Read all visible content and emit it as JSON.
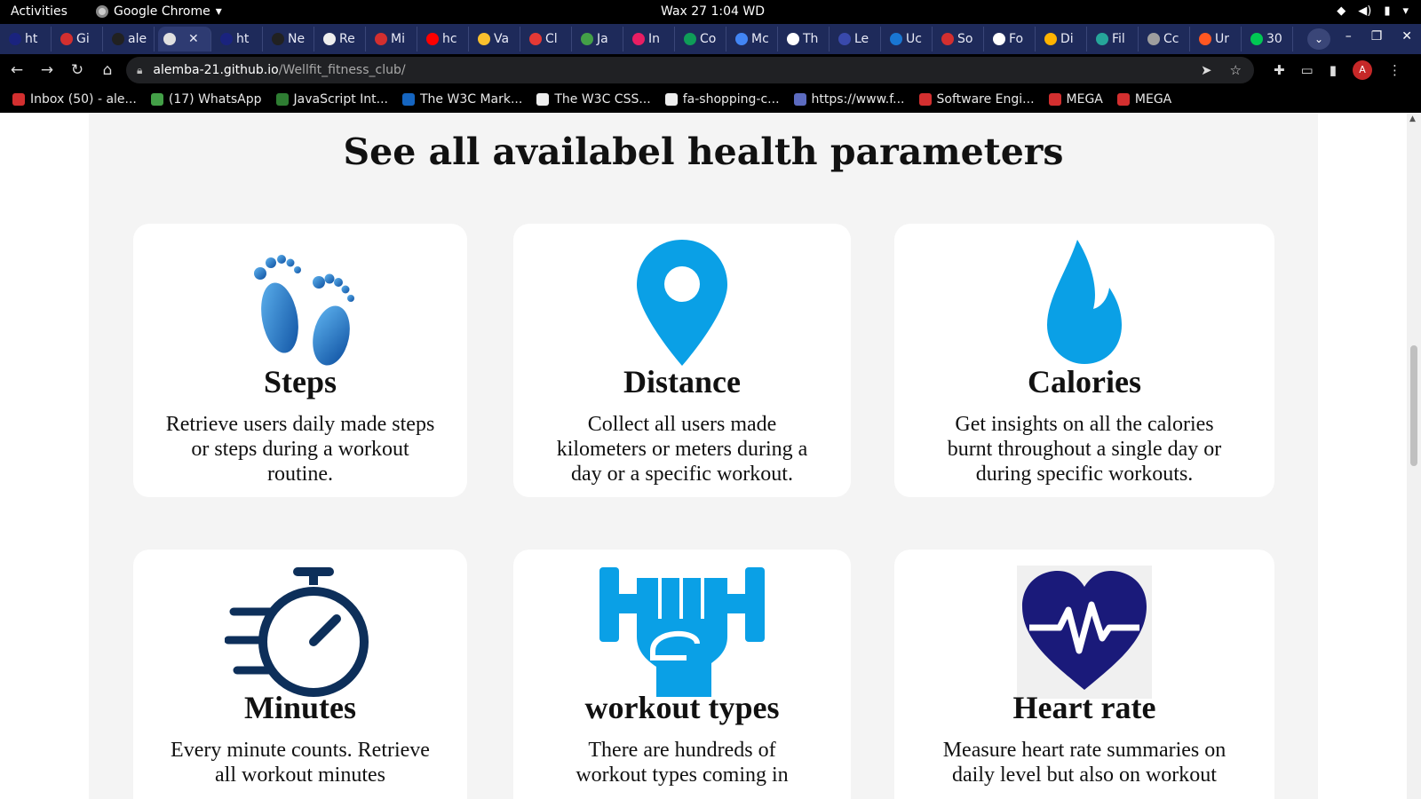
{
  "os_bar": {
    "activities": "Activities",
    "app_name": "Google Chrome",
    "clock": "Wax 27  1:04 WD"
  },
  "tabs": [
    {
      "label": "ht",
      "color": "#1a237e"
    },
    {
      "label": "Gi",
      "color": "#d32f2f"
    },
    {
      "label": "ale",
      "color": "#212121"
    },
    {
      "label": "",
      "color": "#e0e0e0",
      "active": true
    },
    {
      "label": "ht",
      "color": "#1a237e"
    },
    {
      "label": "Ne",
      "color": "#212121"
    },
    {
      "label": "Re",
      "color": "#eeeeee"
    },
    {
      "label": "Mi",
      "color": "#d32f2f"
    },
    {
      "label": "hc",
      "color": "#ff0000"
    },
    {
      "label": "Va",
      "color": "#fbc02d"
    },
    {
      "label": "Cl",
      "color": "#e53935"
    },
    {
      "label": "Ja",
      "color": "#43a047"
    },
    {
      "label": "In",
      "color": "#e91e63"
    },
    {
      "label": "Co",
      "color": "#0f9d58"
    },
    {
      "label": "Mc",
      "color": "#4285f4"
    },
    {
      "label": "Th",
      "color": "#ffffff"
    },
    {
      "label": "Le",
      "color": "#3949ab"
    },
    {
      "label": "Uc",
      "color": "#1976d2"
    },
    {
      "label": "So",
      "color": "#d32f2f"
    },
    {
      "label": "Fo",
      "color": "#ffffff"
    },
    {
      "label": "Di",
      "color": "#ffb300"
    },
    {
      "label": "Fil",
      "color": "#26a69a"
    },
    {
      "label": "Cc",
      "color": "#9e9e9e"
    },
    {
      "label": "Ur",
      "color": "#ff5722"
    },
    {
      "label": "30",
      "color": "#00c853"
    }
  ],
  "address_bar": {
    "domain": "alemba-21.github.io",
    "path": "/Wellfit_fitness_club/"
  },
  "profile_initial": "A",
  "bookmarks": [
    {
      "label": "Inbox (50) - ale...",
      "color": "#d32f2f"
    },
    {
      "label": "(17) WhatsApp",
      "color": "#43a047"
    },
    {
      "label": "JavaScript Int...",
      "color": "#2e7d32"
    },
    {
      "label": "The W3C Mark...",
      "color": "#1565c0"
    },
    {
      "label": "The W3C CSS...",
      "color": "#eeeeee"
    },
    {
      "label": "fa-shopping-c...",
      "color": "#eeeeee"
    },
    {
      "label": "https://www.f...",
      "color": "#5c6bc0"
    },
    {
      "label": "Software Engi...",
      "color": "#d32f2f"
    },
    {
      "label": "MEGA",
      "color": "#d32f2f"
    },
    {
      "label": "MEGA",
      "color": "#d32f2f"
    }
  ],
  "section": {
    "title": "See all availabel health parameters"
  },
  "cards": [
    {
      "icon": "footprints-icon",
      "title": "Steps",
      "text": "Retrieve users daily made steps or steps during a workout routine."
    },
    {
      "icon": "location-pin-icon",
      "title": "Distance",
      "text": "Collect all users made kilometers or meters during a day or a specific workout."
    },
    {
      "icon": "water-drop-icon",
      "title": "Calories",
      "text": "Get insights on all the calories burnt throughout a single day or during specific workouts."
    },
    {
      "icon": "stopwatch-icon",
      "title": "Minutes",
      "text": "Every minute counts. Retrieve all workout minutes"
    },
    {
      "icon": "dumbbell-fist-icon",
      "title": "workout types",
      "text": "There are hundreds of workout types coming in"
    },
    {
      "icon": "heart-rate-icon",
      "title": "Heart rate",
      "text": "Measure heart rate summaries on daily level but also on workout"
    }
  ],
  "colors": {
    "accent_blue": "#0aa0e6",
    "navy": "#0d2f5a",
    "heart_navy": "#1a1a7a"
  }
}
